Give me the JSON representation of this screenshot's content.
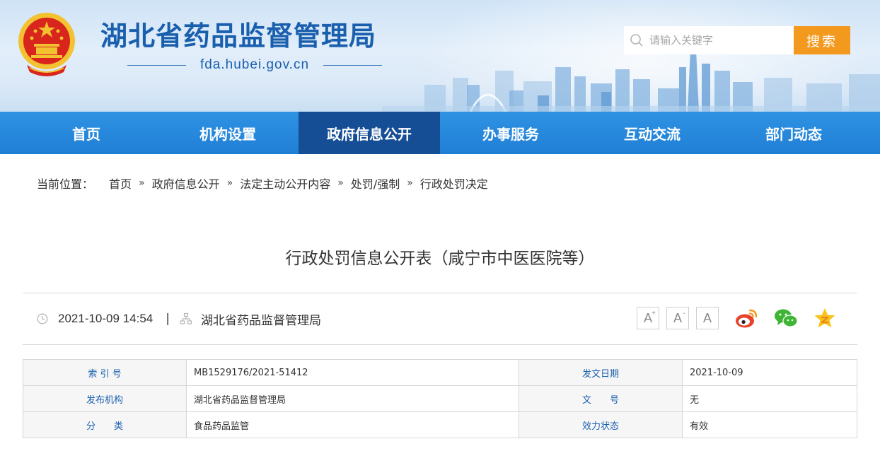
{
  "header": {
    "site_title": "湖北省药品监督管理局",
    "domain": "fda.hubei.gov.cn",
    "search_placeholder": "请输入关键字",
    "search_button": "搜索"
  },
  "nav": {
    "items": [
      {
        "label": "首页"
      },
      {
        "label": "机构设置"
      },
      {
        "label": "政府信息公开",
        "active": true
      },
      {
        "label": "办事服务"
      },
      {
        "label": "互动交流"
      },
      {
        "label": "部门动态"
      }
    ]
  },
  "breadcrumb": {
    "label": "当前位置：",
    "items": [
      "首页",
      "政府信息公开",
      "法定主动公开内容",
      "处罚/强制",
      "行政处罚决定"
    ],
    "separator": "»"
  },
  "article": {
    "title": "行政处罚信息公开表（咸宁市中医医院等）",
    "datetime": "2021-10-09 14:54",
    "meta_separator": "|",
    "publisher": "湖北省药品监督管理局",
    "font_buttons": [
      {
        "glyph": "A",
        "sup": "+"
      },
      {
        "glyph": "A",
        "sup": "-"
      },
      {
        "glyph": "A",
        "sup": ""
      }
    ]
  },
  "info_table": {
    "rows": [
      {
        "k1": "索 引 号",
        "v1": "MB1529176/2021-51412",
        "k2": "发文日期",
        "v2": "2021-10-09"
      },
      {
        "k1": "发布机构",
        "v1": "湖北省药品监督管理局",
        "k2": "文　　号",
        "v2": "无"
      },
      {
        "k1": "分　　类",
        "v1": "食品药品监管",
        "k2": "效力状态",
        "v2": "有效"
      }
    ]
  },
  "colors": {
    "brand_blue": "#1a5fae",
    "nav_blue": "#1f7fd6",
    "nav_active": "#154e95",
    "search_orange": "#f39a1e"
  }
}
